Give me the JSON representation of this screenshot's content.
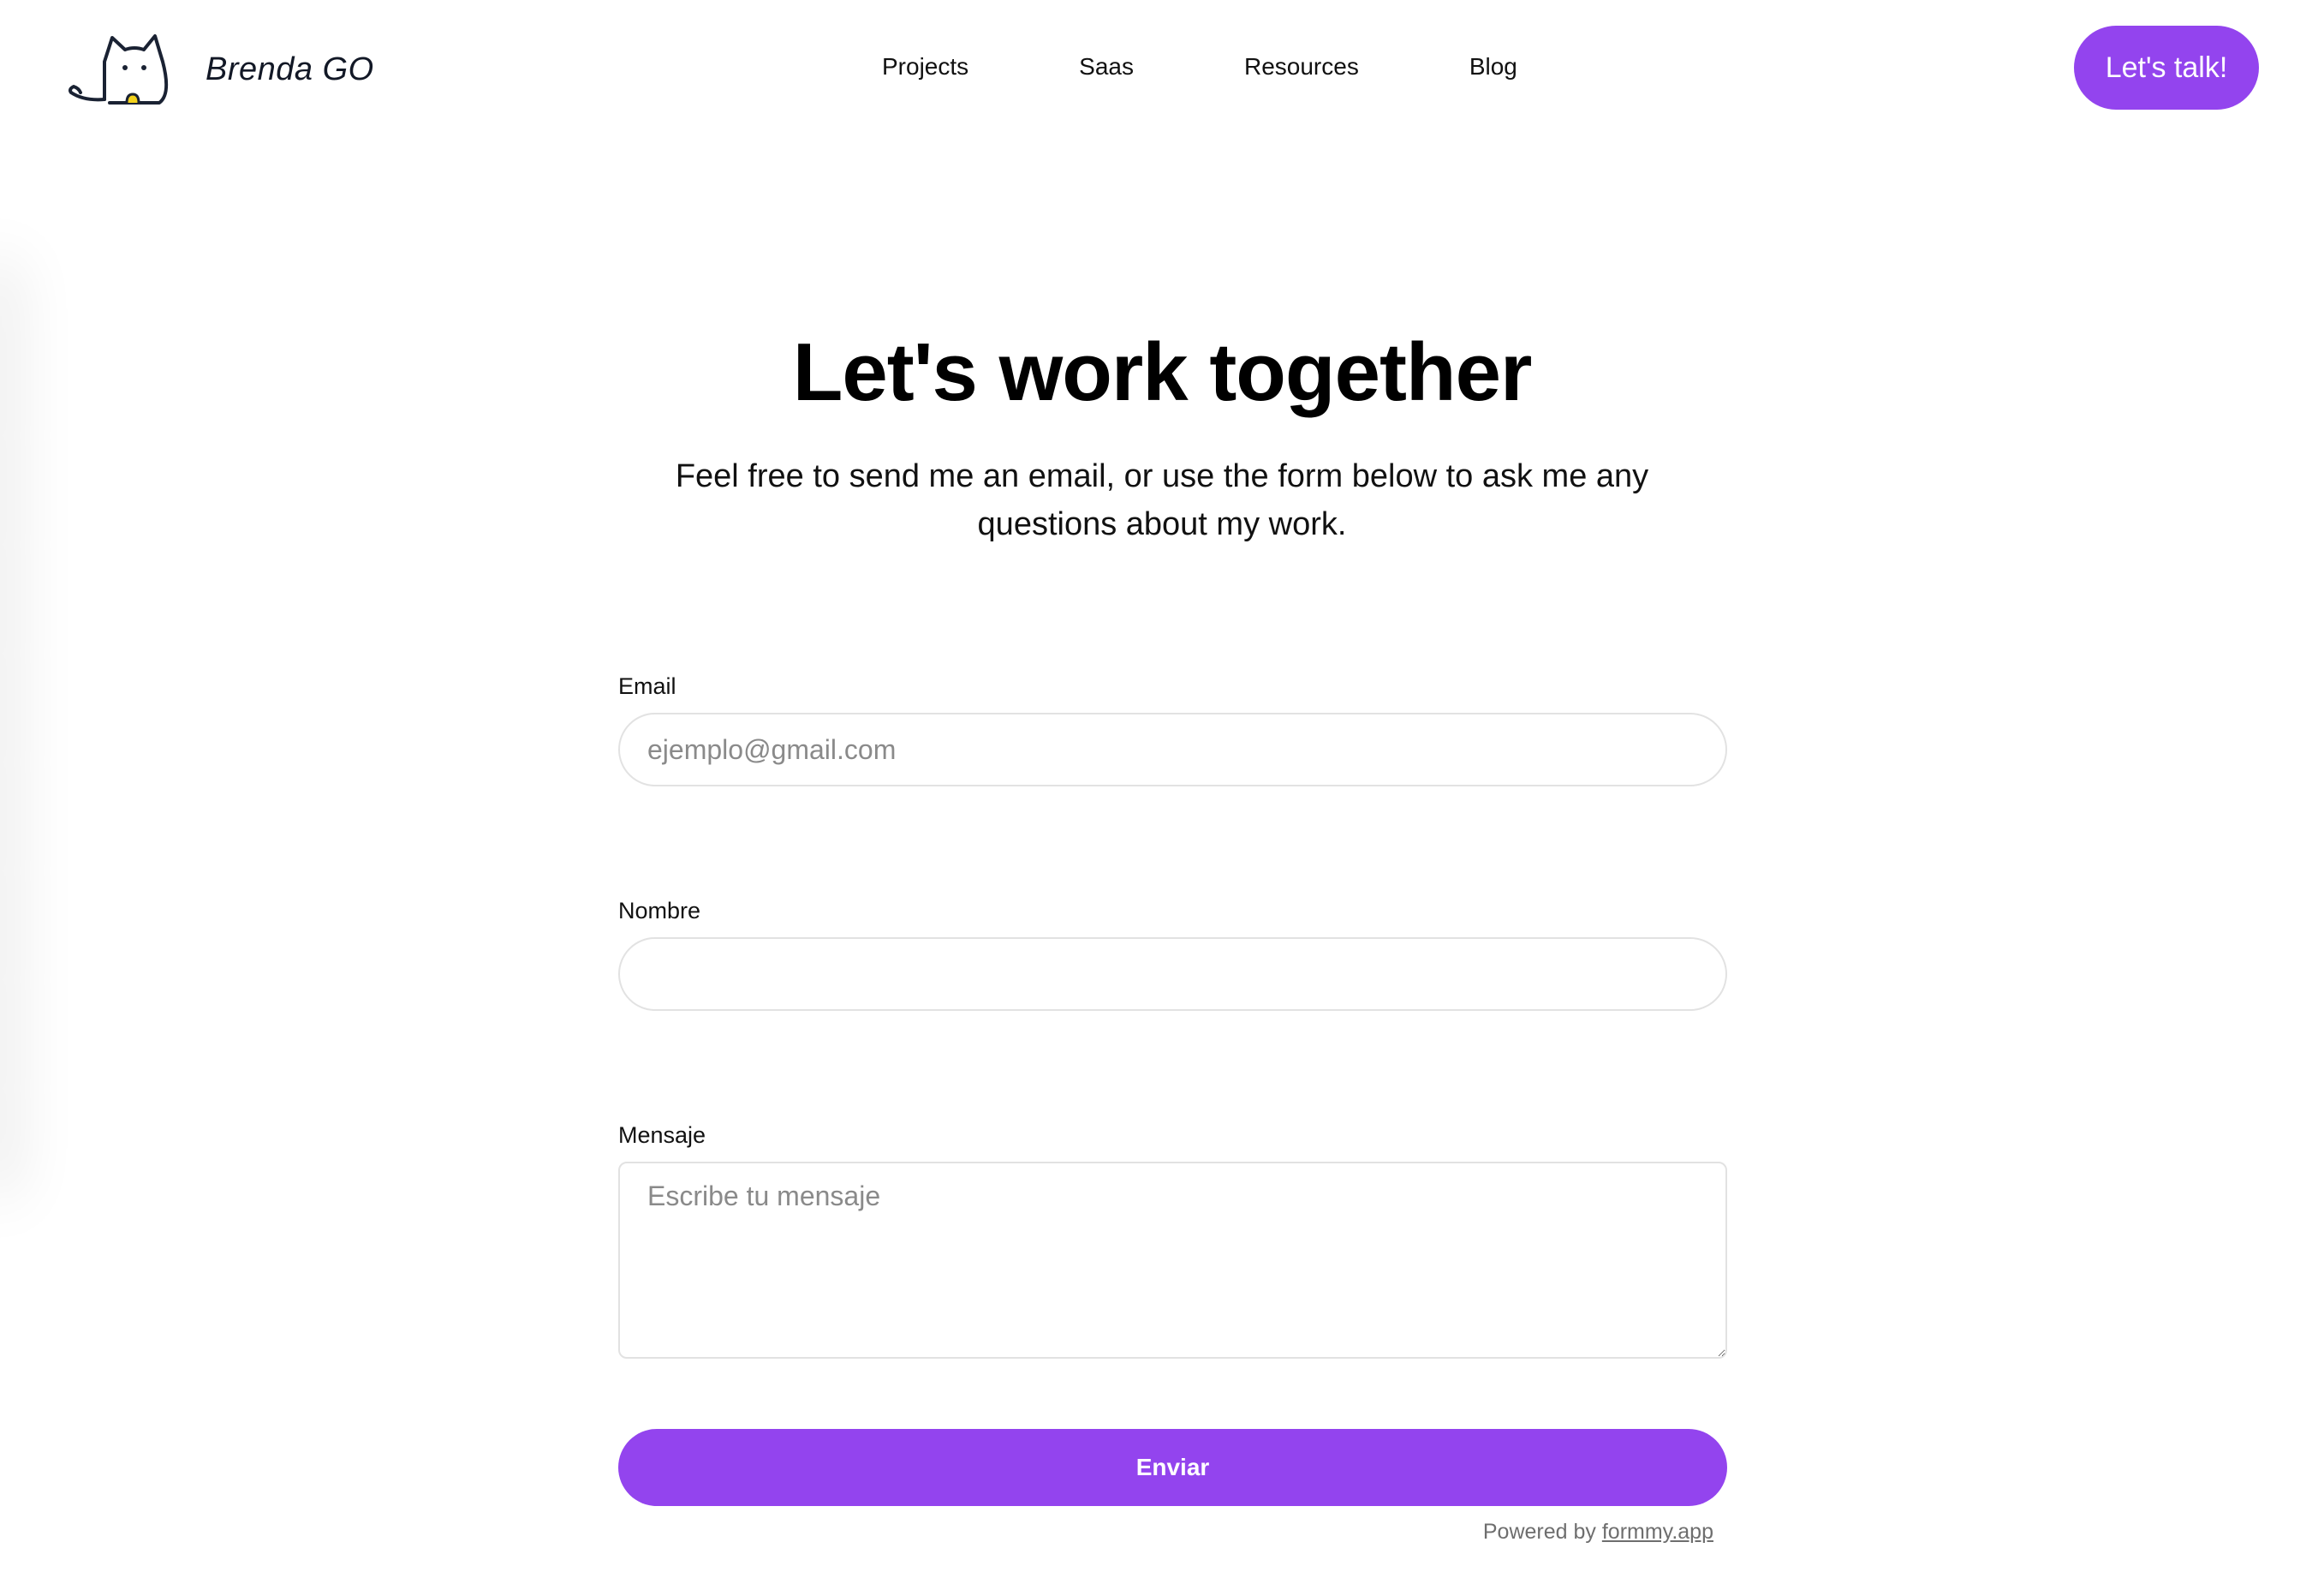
{
  "header": {
    "brand_name": "Brenda GO",
    "nav": [
      "Projects",
      "Saas",
      "Resources",
      "Blog"
    ],
    "cta_label": "Let's talk!"
  },
  "hero": {
    "title": "Let's work together",
    "subtitle": "Feel free to send me an email, or use the form below to ask me any questions about my work."
  },
  "form": {
    "email": {
      "label": "Email",
      "placeholder": "ejemplo@gmail.com",
      "value": ""
    },
    "name": {
      "label": "Nombre",
      "placeholder": "",
      "value": ""
    },
    "message": {
      "label": "Mensaje",
      "placeholder": "Escribe tu mensaje",
      "value": ""
    },
    "submit_label": "Enviar",
    "powered_prefix": "Powered by",
    "powered_link": "formmy.app"
  },
  "icons": {
    "logo": "cat-logo-icon"
  },
  "colors": {
    "accent": "#9344ee",
    "text": "#111111",
    "muted": "#6e6e6e",
    "border": "#e2e2e2",
    "logo_accent": "#f3d21b"
  }
}
